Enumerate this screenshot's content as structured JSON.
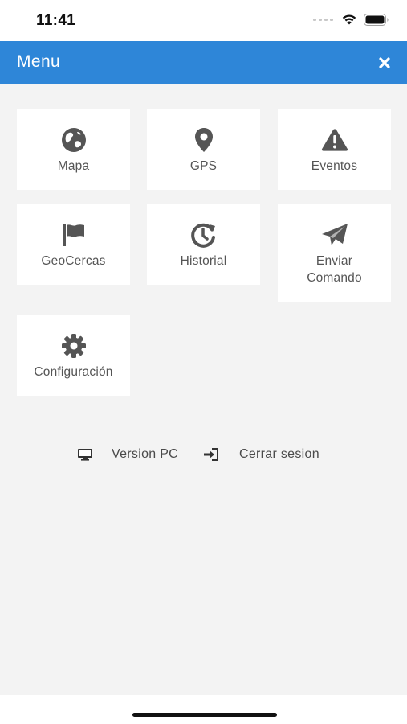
{
  "status_bar": {
    "time": "11:41"
  },
  "header": {
    "title": "Menu",
    "close_icon": "close-icon"
  },
  "menu": {
    "items": [
      {
        "label": "Mapa",
        "icon": "globe-icon"
      },
      {
        "label": "GPS",
        "icon": "map-marker-icon"
      },
      {
        "label": "Eventos",
        "icon": "warning-icon"
      },
      {
        "label": "GeoCercas",
        "icon": "flag-icon"
      },
      {
        "label": "Historial",
        "icon": "history-icon"
      },
      {
        "label": "Enviar\nComando",
        "icon": "paper-plane-icon"
      },
      {
        "label": "Configuración",
        "icon": "gear-icon"
      }
    ]
  },
  "footer": {
    "version_pc": "Version PC",
    "cerrar_sesion": "Cerrar sesion"
  },
  "colors": {
    "header_bg": "#2e86d8",
    "background": "#f3f3f3",
    "tile_bg": "#ffffff",
    "icon": "#555555"
  }
}
